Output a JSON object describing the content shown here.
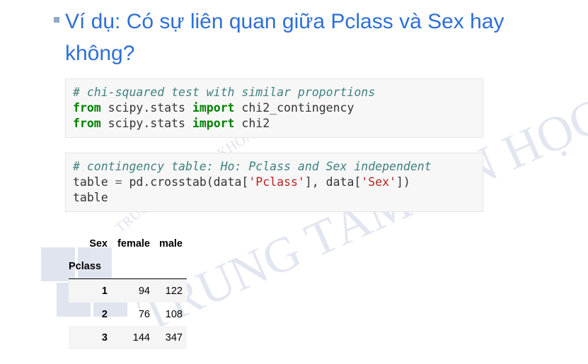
{
  "slide": {
    "bullet_text": "Ví dụ: Có sự liên quan giữa Pclass và Sex hay không?"
  },
  "code_cells": [
    {
      "lines": [
        {
          "comment": "# chi-squared test with similar proportions"
        },
        {
          "kw1": "from",
          "mod": " scipy.stats ",
          "kw2": "import",
          "name": " chi2_contingency"
        },
        {
          "kw1": "from",
          "mod": " scipy.stats ",
          "kw2": "import",
          "name": " chi2"
        }
      ]
    },
    {
      "lines": [
        {
          "comment": "# contingency table: Ho: Pclass and Sex independent"
        },
        {
          "a": "table ",
          "eq": "=",
          "b": " pd.crosstab(data[",
          "s1": "'Pclass'",
          "c": "], data[",
          "s2": "'Sex'",
          "d": "])"
        },
        {
          "plain": "table"
        }
      ]
    }
  ],
  "table": {
    "col_header_label": "Sex",
    "columns": [
      "female",
      "male"
    ],
    "index_label": "Pclass",
    "rows": [
      {
        "index": "1",
        "values": [
          "94",
          "122"
        ]
      },
      {
        "index": "2",
        "values": [
          "76",
          "108"
        ]
      },
      {
        "index": "3",
        "values": [
          "144",
          "347"
        ]
      }
    ]
  },
  "watermark": {
    "arc_text": "TRƯỜNG ĐẠI HỌC KHOA HỌC TỰ NHIÊN",
    "big_text": "TRUNG TÂM TIN HỌC",
    "logo_letters": "TT"
  },
  "colors": {
    "bullet_text": "#2f6fd6",
    "code_bg": "#f7f7f7",
    "keyword": "#008000",
    "comment": "#408080",
    "string": "#ba2121"
  }
}
